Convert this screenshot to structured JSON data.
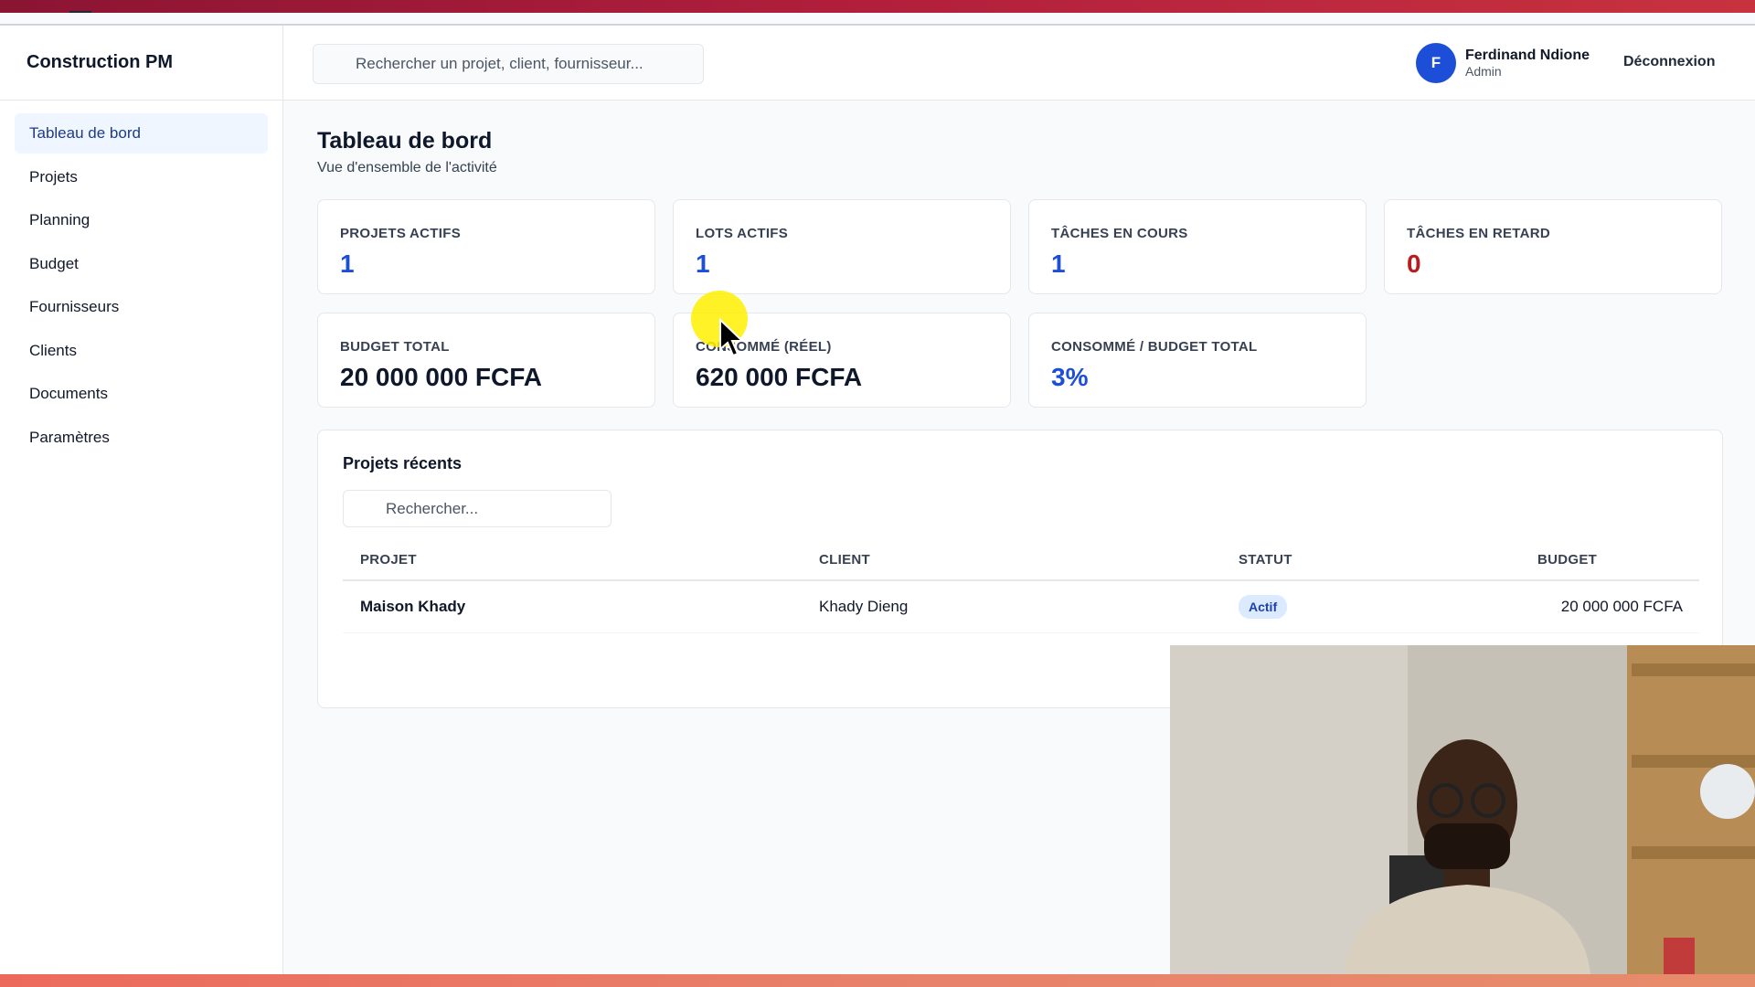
{
  "app": {
    "title": "Construction PM"
  },
  "sidebar": {
    "items": [
      {
        "label": "Tableau de bord",
        "active": true
      },
      {
        "label": "Projets",
        "active": false
      },
      {
        "label": "Planning",
        "active": false
      },
      {
        "label": "Budget",
        "active": false
      },
      {
        "label": "Fournisseurs",
        "active": false
      },
      {
        "label": "Clients",
        "active": false
      },
      {
        "label": "Documents",
        "active": false
      },
      {
        "label": "Paramètres",
        "active": false
      }
    ]
  },
  "header": {
    "search_placeholder": "Rechercher un projet, client, fournisseur...",
    "user": {
      "initial": "F",
      "name": "Ferdinand Ndione",
      "role": "Admin"
    },
    "logout_label": "Déconnexion"
  },
  "page": {
    "title": "Tableau de bord",
    "subtitle": "Vue d'ensemble de l'activité"
  },
  "stats": {
    "projets_actifs": {
      "label": "PROJETS ACTIFS",
      "value": "1"
    },
    "lots_actifs": {
      "label": "LOTS ACTIFS",
      "value": "1"
    },
    "taches_en_cours": {
      "label": "TÂCHES EN COURS",
      "value": "1"
    },
    "taches_en_retard": {
      "label": "TÂCHES EN RETARD",
      "value": "0"
    },
    "budget_total": {
      "label": "BUDGET TOTAL",
      "value": "20 000 000 FCFA"
    },
    "consomme_reel": {
      "label": "CONSOMMÉ (RÉEL)",
      "value": "620 000 FCFA"
    },
    "consomme_budget": {
      "label": "CONSOMMÉ / BUDGET TOTAL",
      "value": "3%"
    }
  },
  "recent": {
    "title": "Projets récents",
    "search_placeholder": "Rechercher...",
    "columns": {
      "projet": "PROJET",
      "client": "CLIENT",
      "statut": "STATUT",
      "budget": "BUDGET"
    },
    "rows": [
      {
        "projet": "Maison Khady",
        "client": "Khady Dieng",
        "statut": "Actif",
        "budget": "20 000 000 FCFA"
      }
    ]
  },
  "colors": {
    "accent_blue": "#1d4ed8",
    "alert_red": "#b91c1c",
    "active_nav_bg": "#eff6ff",
    "badge_bg": "#dbeafe"
  }
}
